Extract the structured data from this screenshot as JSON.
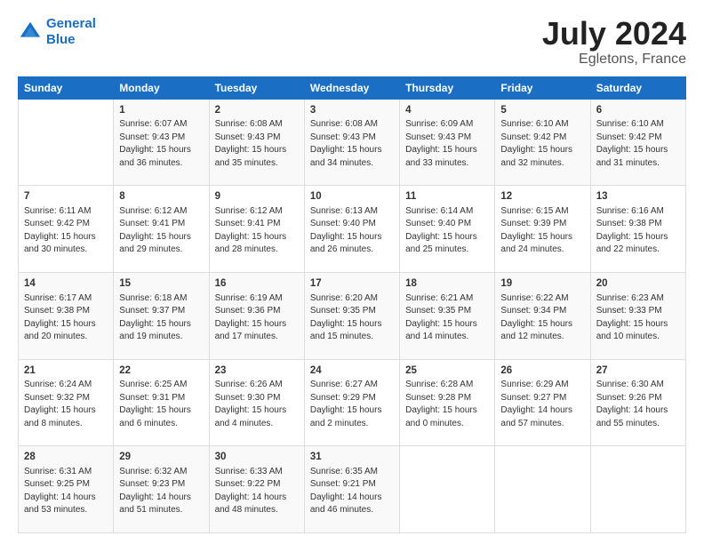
{
  "logo": {
    "line1": "General",
    "line2": "Blue"
  },
  "title": "July 2024",
  "subtitle": "Egletons, France",
  "days_header": [
    "Sunday",
    "Monday",
    "Tuesday",
    "Wednesday",
    "Thursday",
    "Friday",
    "Saturday"
  ],
  "weeks": [
    [
      {
        "num": "",
        "info": ""
      },
      {
        "num": "1",
        "info": "Sunrise: 6:07 AM\nSunset: 9:43 PM\nDaylight: 15 hours\nand 36 minutes."
      },
      {
        "num": "2",
        "info": "Sunrise: 6:08 AM\nSunset: 9:43 PM\nDaylight: 15 hours\nand 35 minutes."
      },
      {
        "num": "3",
        "info": "Sunrise: 6:08 AM\nSunset: 9:43 PM\nDaylight: 15 hours\nand 34 minutes."
      },
      {
        "num": "4",
        "info": "Sunrise: 6:09 AM\nSunset: 9:43 PM\nDaylight: 15 hours\nand 33 minutes."
      },
      {
        "num": "5",
        "info": "Sunrise: 6:10 AM\nSunset: 9:42 PM\nDaylight: 15 hours\nand 32 minutes."
      },
      {
        "num": "6",
        "info": "Sunrise: 6:10 AM\nSunset: 9:42 PM\nDaylight: 15 hours\nand 31 minutes."
      }
    ],
    [
      {
        "num": "7",
        "info": "Sunrise: 6:11 AM\nSunset: 9:42 PM\nDaylight: 15 hours\nand 30 minutes."
      },
      {
        "num": "8",
        "info": "Sunrise: 6:12 AM\nSunset: 9:41 PM\nDaylight: 15 hours\nand 29 minutes."
      },
      {
        "num": "9",
        "info": "Sunrise: 6:12 AM\nSunset: 9:41 PM\nDaylight: 15 hours\nand 28 minutes."
      },
      {
        "num": "10",
        "info": "Sunrise: 6:13 AM\nSunset: 9:40 PM\nDaylight: 15 hours\nand 26 minutes."
      },
      {
        "num": "11",
        "info": "Sunrise: 6:14 AM\nSunset: 9:40 PM\nDaylight: 15 hours\nand 25 minutes."
      },
      {
        "num": "12",
        "info": "Sunrise: 6:15 AM\nSunset: 9:39 PM\nDaylight: 15 hours\nand 24 minutes."
      },
      {
        "num": "13",
        "info": "Sunrise: 6:16 AM\nSunset: 9:38 PM\nDaylight: 15 hours\nand 22 minutes."
      }
    ],
    [
      {
        "num": "14",
        "info": "Sunrise: 6:17 AM\nSunset: 9:38 PM\nDaylight: 15 hours\nand 20 minutes."
      },
      {
        "num": "15",
        "info": "Sunrise: 6:18 AM\nSunset: 9:37 PM\nDaylight: 15 hours\nand 19 minutes."
      },
      {
        "num": "16",
        "info": "Sunrise: 6:19 AM\nSunset: 9:36 PM\nDaylight: 15 hours\nand 17 minutes."
      },
      {
        "num": "17",
        "info": "Sunrise: 6:20 AM\nSunset: 9:35 PM\nDaylight: 15 hours\nand 15 minutes."
      },
      {
        "num": "18",
        "info": "Sunrise: 6:21 AM\nSunset: 9:35 PM\nDaylight: 15 hours\nand 14 minutes."
      },
      {
        "num": "19",
        "info": "Sunrise: 6:22 AM\nSunset: 9:34 PM\nDaylight: 15 hours\nand 12 minutes."
      },
      {
        "num": "20",
        "info": "Sunrise: 6:23 AM\nSunset: 9:33 PM\nDaylight: 15 hours\nand 10 minutes."
      }
    ],
    [
      {
        "num": "21",
        "info": "Sunrise: 6:24 AM\nSunset: 9:32 PM\nDaylight: 15 hours\nand 8 minutes."
      },
      {
        "num": "22",
        "info": "Sunrise: 6:25 AM\nSunset: 9:31 PM\nDaylight: 15 hours\nand 6 minutes."
      },
      {
        "num": "23",
        "info": "Sunrise: 6:26 AM\nSunset: 9:30 PM\nDaylight: 15 hours\nand 4 minutes."
      },
      {
        "num": "24",
        "info": "Sunrise: 6:27 AM\nSunset: 9:29 PM\nDaylight: 15 hours\nand 2 minutes."
      },
      {
        "num": "25",
        "info": "Sunrise: 6:28 AM\nSunset: 9:28 PM\nDaylight: 15 hours\nand 0 minutes."
      },
      {
        "num": "26",
        "info": "Sunrise: 6:29 AM\nSunset: 9:27 PM\nDaylight: 14 hours\nand 57 minutes."
      },
      {
        "num": "27",
        "info": "Sunrise: 6:30 AM\nSunset: 9:26 PM\nDaylight: 14 hours\nand 55 minutes."
      }
    ],
    [
      {
        "num": "28",
        "info": "Sunrise: 6:31 AM\nSunset: 9:25 PM\nDaylight: 14 hours\nand 53 minutes."
      },
      {
        "num": "29",
        "info": "Sunrise: 6:32 AM\nSunset: 9:23 PM\nDaylight: 14 hours\nand 51 minutes."
      },
      {
        "num": "30",
        "info": "Sunrise: 6:33 AM\nSunset: 9:22 PM\nDaylight: 14 hours\nand 48 minutes."
      },
      {
        "num": "31",
        "info": "Sunrise: 6:35 AM\nSunset: 9:21 PM\nDaylight: 14 hours\nand 46 minutes."
      },
      {
        "num": "",
        "info": ""
      },
      {
        "num": "",
        "info": ""
      },
      {
        "num": "",
        "info": ""
      }
    ]
  ]
}
